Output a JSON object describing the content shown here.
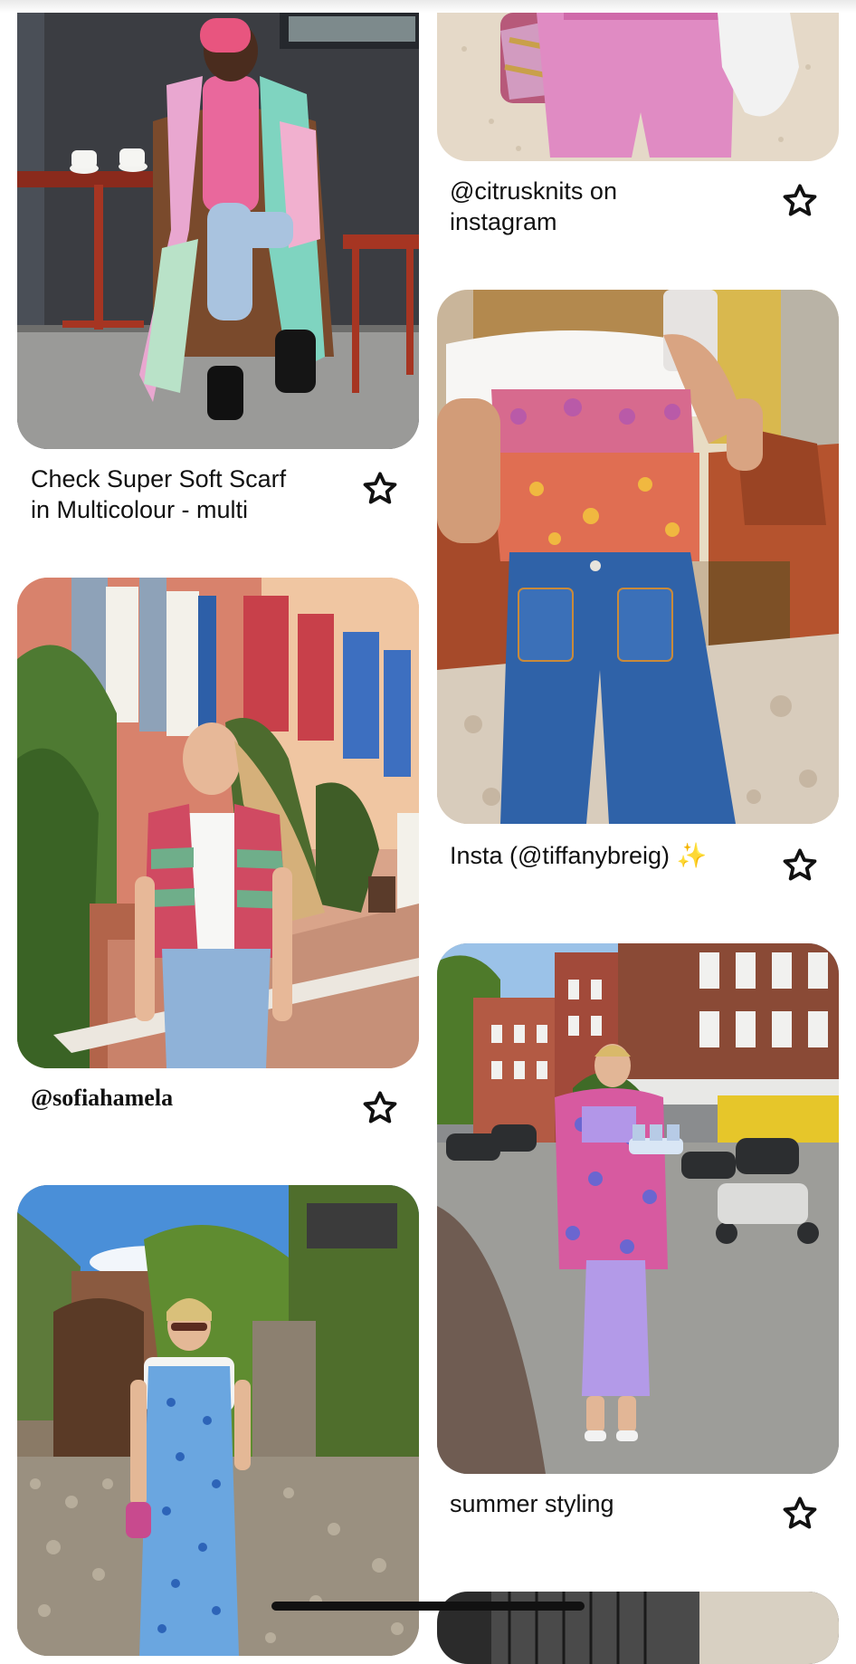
{
  "feed": {
    "pins": [
      {
        "title": "Check Super Soft Scarf\nin Multicolour - multi",
        "save_icon": "star-outline-icon"
      },
      {
        "title": "@citrusknits on\ninstagram",
        "save_icon": "star-outline-icon"
      },
      {
        "title": "@sofiahamela",
        "save_icon": "star-outline-icon"
      },
      {
        "title": "Insta (@tiffanybreig) ✨",
        "save_icon": "star-outline-icon"
      },
      {
        "title": "",
        "save_icon": ""
      },
      {
        "title": "summer styling",
        "save_icon": "star-outline-icon"
      },
      {
        "title": "",
        "save_icon": ""
      }
    ]
  },
  "colors": {
    "background": "#ffffff",
    "text": "#111111",
    "icon": "#111111"
  }
}
